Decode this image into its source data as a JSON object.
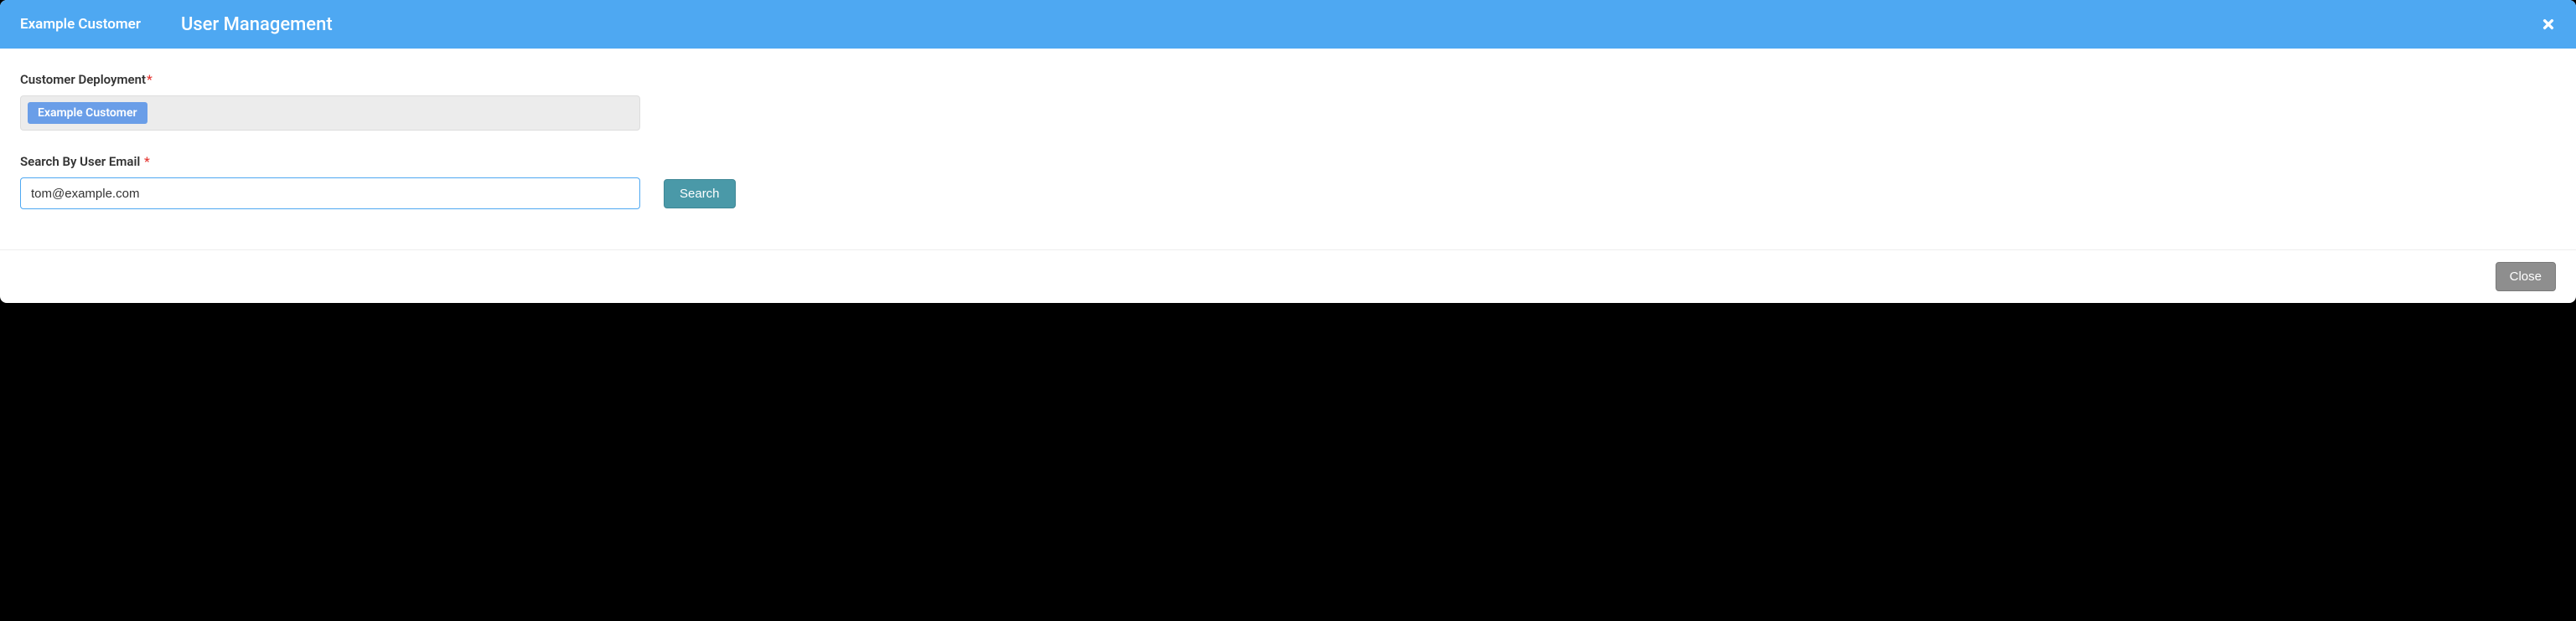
{
  "header": {
    "customer": "Example Customer",
    "title": "User Management"
  },
  "form": {
    "deployment": {
      "label": "Customer Deployment",
      "chip": "Example Customer"
    },
    "email_search": {
      "label": "Search By User Email",
      "value": "tom@example.com",
      "search_button": "Search"
    }
  },
  "footer": {
    "close_button": "Close"
  }
}
